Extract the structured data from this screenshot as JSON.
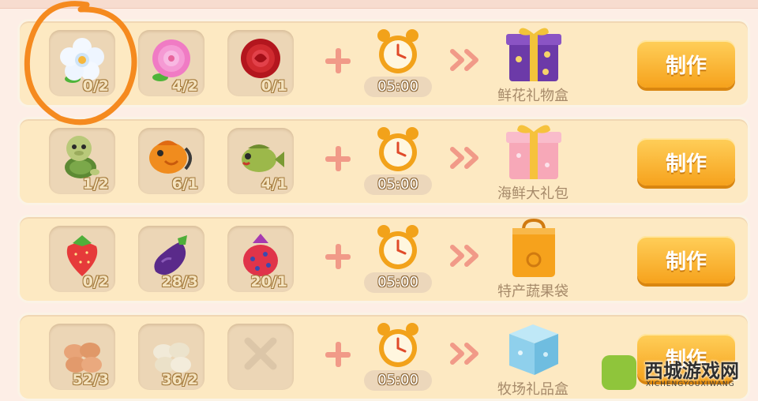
{
  "recipes": [
    {
      "ingredients": [
        {
          "icon": "white-flower-icon",
          "count": "0/2"
        },
        {
          "icon": "pink-flower-icon",
          "count": "4/2"
        },
        {
          "icon": "red-rose-icon",
          "count": "0/1"
        }
      ],
      "time": "05:00",
      "product": {
        "icon": "purple-gift-box-icon",
        "name": "鲜花礼物盒"
      },
      "button_label": "制作"
    },
    {
      "ingredients": [
        {
          "icon": "turtle-icon",
          "count": "1/2"
        },
        {
          "icon": "orange-fish-icon",
          "count": "6/1"
        },
        {
          "icon": "green-fish-icon",
          "count": "4/1"
        }
      ],
      "time": "05:00",
      "product": {
        "icon": "pink-gift-box-icon",
        "name": "海鲜大礼包"
      },
      "button_label": "制作"
    },
    {
      "ingredients": [
        {
          "icon": "strawberry-icon",
          "count": "0/2"
        },
        {
          "icon": "eggplant-icon",
          "count": "28/3"
        },
        {
          "icon": "dragon-fruit-icon",
          "count": "20/1"
        }
      ],
      "time": "05:00",
      "product": {
        "icon": "orange-bag-icon",
        "name": "特产蔬果袋"
      },
      "button_label": "制作"
    },
    {
      "ingredients": [
        {
          "icon": "brown-eggs-icon",
          "count": "52/3"
        },
        {
          "icon": "white-eggs-icon",
          "count": "36/2"
        },
        {
          "icon": "empty-slot-x-icon",
          "count": ""
        }
      ],
      "time": "05:00",
      "product": {
        "icon": "blue-gift-box-icon",
        "name": "牧场礼品盒"
      },
      "button_label": "制作"
    }
  ],
  "watermark": {
    "title": "西城游戏网",
    "subtitle": "XICHENGYOUXIWANG"
  },
  "colors": {
    "row_bg": "#fde9c2",
    "slot_bg": "#ecd6b6",
    "button": "#f6a21c",
    "plus": "#f19a88",
    "highlight_circle": "#f58a1f"
  }
}
